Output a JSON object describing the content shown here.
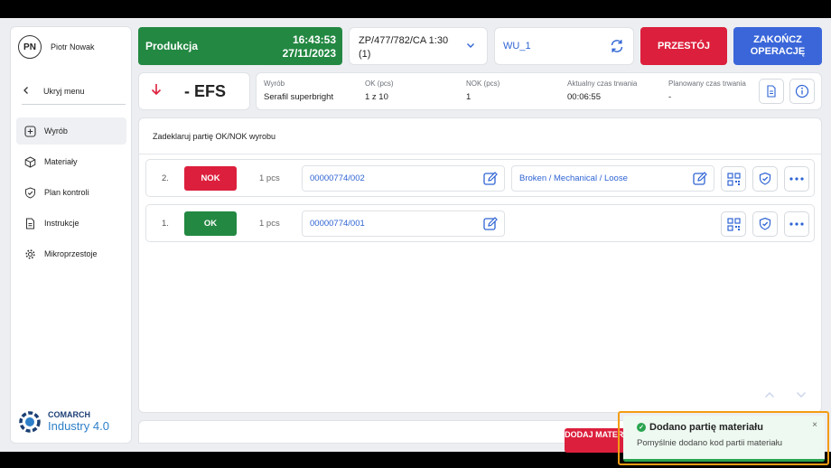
{
  "user": {
    "initials": "PN",
    "name": "Piotr Nowak"
  },
  "sidebar": {
    "hide_menu": "Ukryj menu",
    "items": [
      {
        "label": "Wyrób",
        "icon": "plus-square-icon",
        "active": true
      },
      {
        "label": "Materiały",
        "icon": "cube-icon"
      },
      {
        "label": "Plan kontroli",
        "icon": "shield-check-icon"
      },
      {
        "label": "Instrukcje",
        "icon": "document-icon"
      },
      {
        "label": "Mikroprzestoje",
        "icon": "gear-icon"
      }
    ]
  },
  "brand": {
    "line1": "COMARCH",
    "line2": "Industry 4.0"
  },
  "header": {
    "status": "Produkcja",
    "time": "16:43:53",
    "date": "27/11/2023",
    "status_color": "#238842",
    "order_line1": "ZP/477/782/CA 1:30",
    "order_line2": "(1)",
    "workunit": "WU_1",
    "downtime_label": "PRZESTÓJ",
    "finish_label_1": "ZAKOŃCZ",
    "finish_label_2": "OPERACJĘ"
  },
  "operation": {
    "name": "- EFS"
  },
  "info": {
    "product_label": "Wyrób",
    "product_value": "Serafil superbright",
    "ok_label": "OK (pcs)",
    "ok_value": "1 z 10",
    "nok_label": "NOK (pcs)",
    "nok_value": "1",
    "current_time_label": "Aktualny czas trwania",
    "current_time_value": "00:06:55",
    "planned_time_label": "Planowany czas trwania",
    "planned_time_value": "-"
  },
  "main": {
    "title": "Zadeklaruj partię OK/NOK wyrobu",
    "rows": [
      {
        "num": "2.",
        "status": "NOK",
        "qty": "1 pcs",
        "batch": "00000774/002",
        "reason": "Broken / Mechanical / Loose"
      },
      {
        "num": "1.",
        "status": "OK",
        "qty": "1 pcs",
        "batch": "00000774/001"
      }
    ]
  },
  "bottom": {
    "add_button": "DODAJ MATERIAŁ"
  },
  "toast": {
    "title": "Dodano partię materiału",
    "message": "Pomyślnie dodano kod partii materiału",
    "close": "×"
  }
}
